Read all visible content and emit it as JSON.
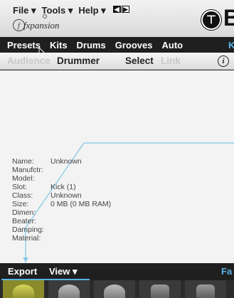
{
  "menu": {
    "file": "File ▾",
    "tools": "Tools ▾",
    "help": "Help ▾"
  },
  "logo": {
    "text": "fxpansion",
    "circle_letter": "f"
  },
  "brand": {
    "badge_glyph": "⊤",
    "letter": "B"
  },
  "tabs": [
    {
      "label": "Presets"
    },
    {
      "label": "Kits"
    },
    {
      "label": "Drums"
    },
    {
      "label": "Grooves"
    },
    {
      "label": "Auto"
    },
    {
      "label": "Kit"
    }
  ],
  "subtabs": {
    "audience": "Audience",
    "drummer": "Drummer",
    "select": "Select",
    "link": "Link"
  },
  "info": {
    "rows": [
      {
        "label": "Name:",
        "value": "Unknown"
      },
      {
        "label": "Manufctr:",
        "value": ""
      },
      {
        "label": "Model:",
        "value": ""
      },
      {
        "label": "Slot:",
        "value": "Kick (1)"
      },
      {
        "label": "Class:",
        "value": "Unknown"
      },
      {
        "label": "Size:",
        "value": "0 MB (0 MB RAM)"
      },
      {
        "label": "Dimen:",
        "value": ""
      },
      {
        "label": "Beater:",
        "value": ""
      },
      {
        "label": "Damping:",
        "value": ""
      },
      {
        "label": "Material:",
        "value": ""
      }
    ]
  },
  "bottom": {
    "export": "Export",
    "view": "View ▾",
    "fa": "Fa"
  },
  "colors": {
    "accent": "#58b4e8",
    "bar_dark": "#1f1f1f",
    "panel": "#f3f3f3"
  }
}
